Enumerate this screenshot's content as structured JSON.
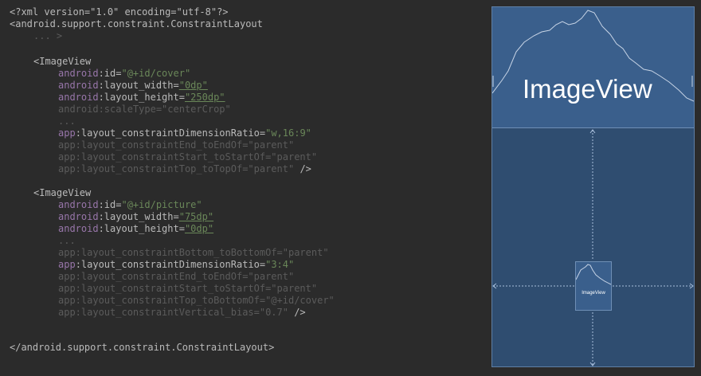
{
  "code": {
    "xml_decl": "<?xml version=\"1.0\" encoding=\"utf-8\"?>",
    "root_open": "<android.support.constraint.ConstraintLayout",
    "root_fold": "... >",
    "image_tag": "<ImageView",
    "views": [
      {
        "id": "\"@+id/cover\"",
        "width": "\"0dp\"",
        "height": "\"250dp\"",
        "scale_type": "android:scaleType=\"centerCrop\"",
        "ratio": "\"w,16:9\"",
        "faded": [
          "app:layout_constraintEnd_toEndOf=\"parent\"",
          "app:layout_constraintStart_toStartOf=\"parent\"",
          "app:layout_constraintTop_toTopOf=\"parent\""
        ]
      },
      {
        "id": "\"@+id/picture\"",
        "width": "\"75dp\"",
        "height": "\"0dp\"",
        "bottom": "app:layout_constraintBottom_toBottomOf=\"parent\"",
        "ratio": "\"3:4\"",
        "faded": [
          "app:layout_constraintEnd_toEndOf=\"parent\"",
          "app:layout_constraintStart_toStartOf=\"parent\"",
          "app:layout_constraintTop_toBottomOf=\"@+id/cover\"",
          "app:layout_constraintVertical_bias=\"0.7\""
        ]
      }
    ],
    "fold": "...",
    "self_close": " />",
    "root_close": "</android.support.constraint.ConstraintLayout>"
  },
  "preview": {
    "cover_label": "ImageView",
    "picture_label": "ImageView"
  },
  "colors": {
    "background": "#2b2b2b",
    "tag": "#e8bf6a",
    "attribute": "#bababa",
    "namespace": "#9876aa",
    "value": "#6a8759",
    "faded": "#5b5b5b",
    "preview_bg": "#2f4d70",
    "image_bg": "#3a5f8c"
  }
}
